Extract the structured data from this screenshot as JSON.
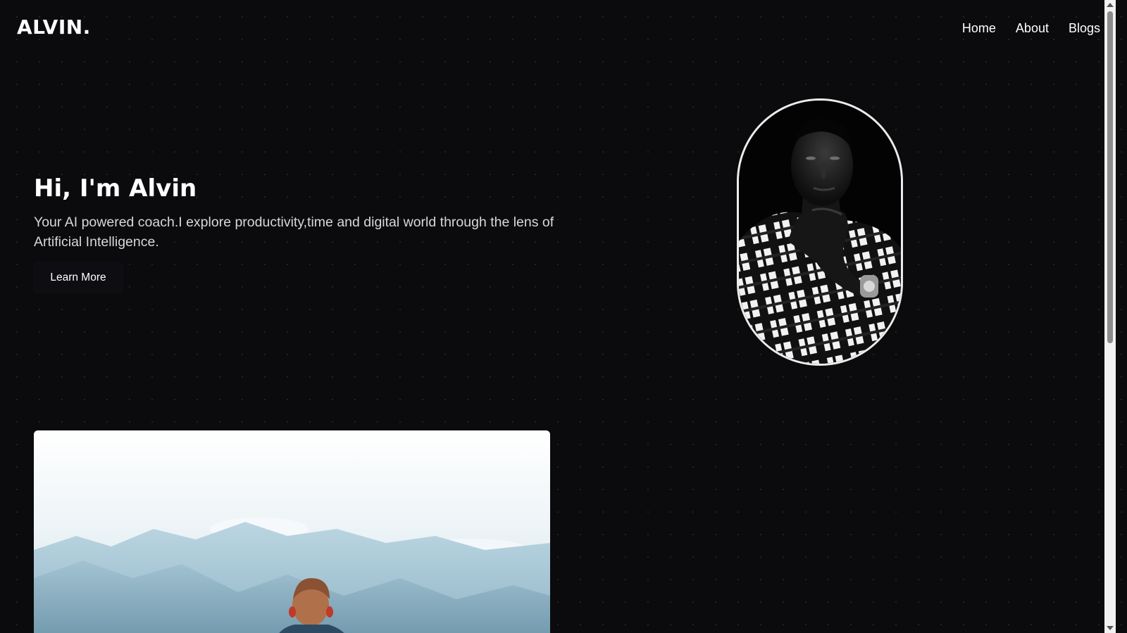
{
  "header": {
    "logo": "ALVIN.",
    "nav": [
      {
        "label": "Home"
      },
      {
        "label": "About"
      },
      {
        "label": "Blogs"
      }
    ]
  },
  "hero": {
    "title": "Hi, I'm Alvin",
    "description": "Your AI powered coach.I explore productivity,time and digital world through the lens of Artificial Intelligence.",
    "button_label": "Learn More",
    "portrait_icon": "portrait-photo",
    "portrait_border_color": "#ececec"
  },
  "feature_image": {
    "icon": "mountain-landscape-photo"
  },
  "colors": {
    "background": "#0b0b0e",
    "text": "#ffffff",
    "muted_text": "#d7d7dc"
  }
}
